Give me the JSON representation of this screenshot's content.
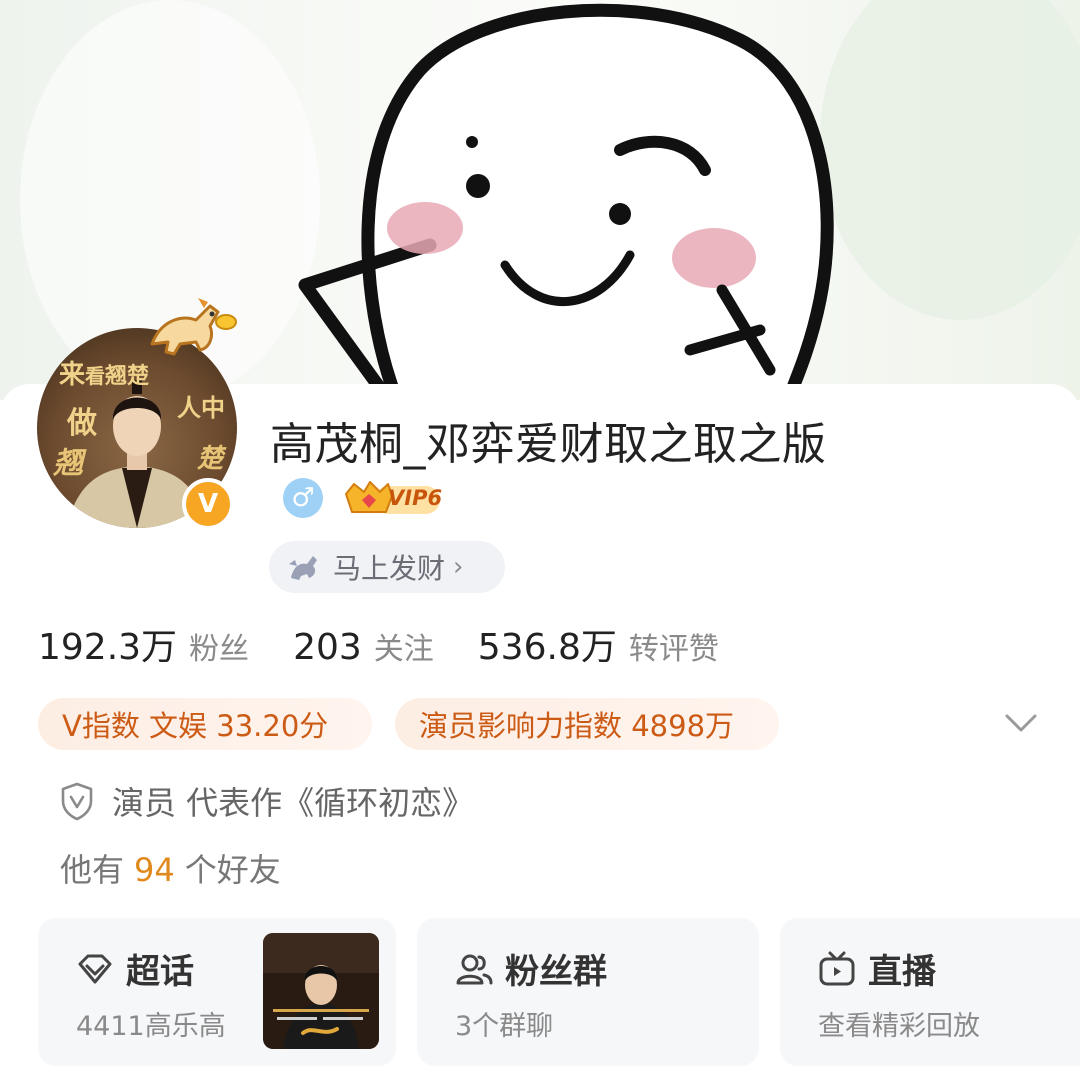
{
  "profile": {
    "name": "高茂桐_邓弈爱财取之取之版",
    "verified_badge": "V",
    "gender_symbol": "♂",
    "vip_label": "VIP6",
    "title_pill": "马上发财",
    "title_pill_chevron": "›",
    "avatar_text": [
      "来",
      "看",
      "翘",
      "楚",
      "做",
      "人",
      "中",
      "翘",
      "楚"
    ]
  },
  "stats": [
    {
      "value": "192.3万",
      "label": "粉丝"
    },
    {
      "value": "203",
      "label": "关注"
    },
    {
      "value": "536.8万",
      "label": "转评赞"
    }
  ],
  "indices": {
    "v_index": "V指数 文娱 33.20分",
    "actor_index": "演员影响力指数 4898万"
  },
  "verification": "演员 代表作《循环初恋》",
  "friends": {
    "prefix": "他有",
    "count": "94",
    "suffix": "个好友"
  },
  "cards": [
    {
      "title": "超话",
      "subtitle": "4411高乐高",
      "icon": "diamond-icon"
    },
    {
      "title": "粉丝群",
      "subtitle": "3个群聊",
      "icon": "group-icon"
    },
    {
      "title": "直播",
      "subtitle": "查看精彩回放",
      "icon": "tv-icon"
    }
  ],
  "colors": {
    "accent_orange": "#cc5b16",
    "vip_gold": "#f6a623",
    "friends_count": "#e08a1e"
  }
}
